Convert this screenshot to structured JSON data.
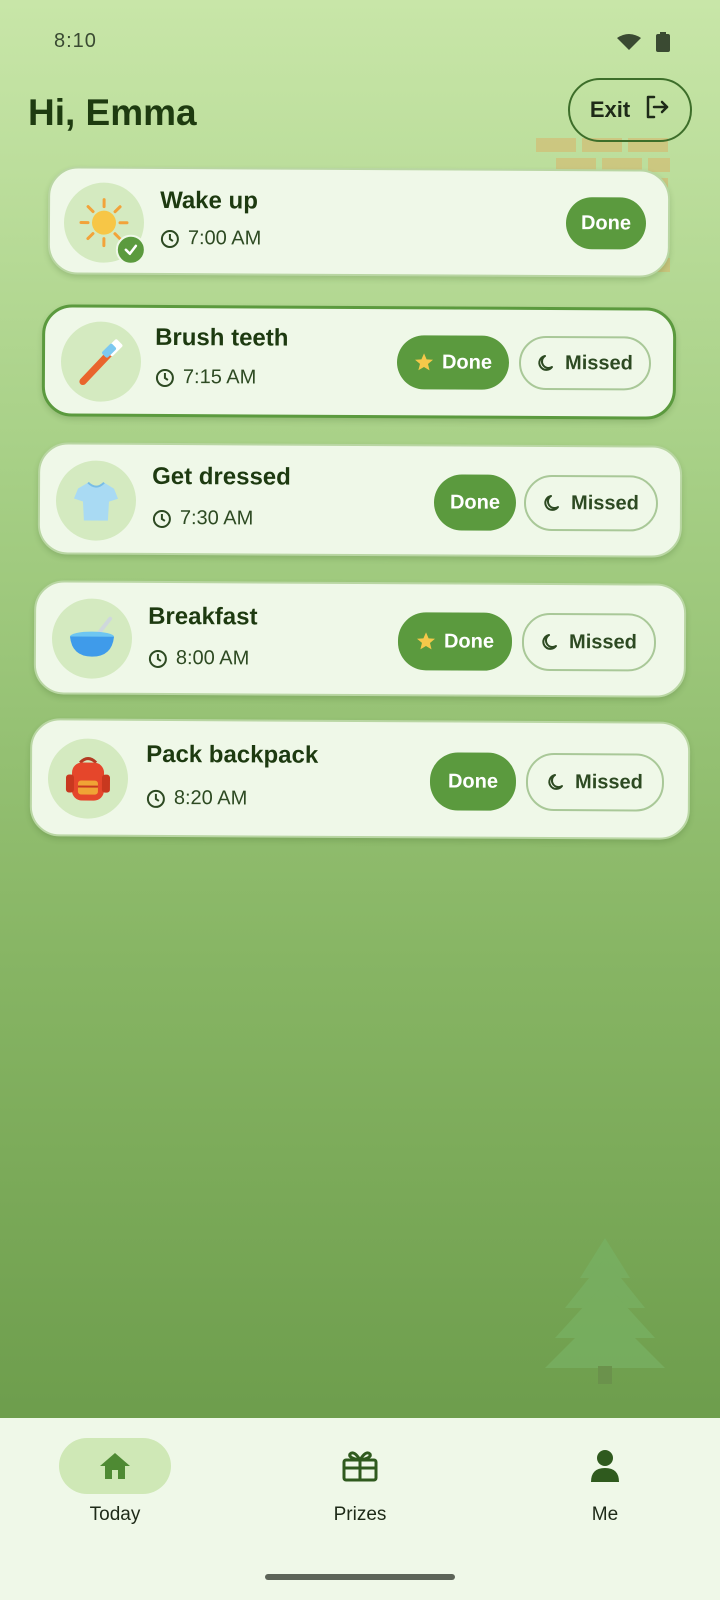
{
  "status_bar": {
    "time": "8:10",
    "icons": [
      "signal-icon",
      "battery-icon"
    ]
  },
  "header": {
    "greeting": "Hi, Emma",
    "exit_label": "Exit"
  },
  "tasks": [
    {
      "title": "Wake up",
      "time": "7:00 AM",
      "icon": "sun-icon",
      "completed": true,
      "done_label": "Done"
    },
    {
      "title": "Brush teeth",
      "time": "7:15 AM",
      "icon": "toothbrush-icon",
      "done_label": "Done",
      "missed_label": "Missed",
      "starred": true
    },
    {
      "title": "Get dressed",
      "time": "7:30 AM",
      "icon": "tshirt-icon",
      "done_label": "Done",
      "missed_label": "Missed"
    },
    {
      "title": "Breakfast",
      "time": "8:00 AM",
      "icon": "bowl-icon",
      "done_label": "Done",
      "missed_label": "Missed",
      "starred": true
    },
    {
      "title": "Pack backpack",
      "time": "8:20 AM",
      "icon": "backpack-icon",
      "done_label": "Done",
      "missed_label": "Missed"
    }
  ],
  "nav": [
    {
      "label": "Today",
      "icon": "home-icon",
      "active": true
    },
    {
      "label": "Prizes",
      "icon": "gift-icon"
    },
    {
      "label": "Me",
      "icon": "person-icon"
    }
  ],
  "colors": {
    "accent": "#5b9a3e",
    "card": "#eff8e8",
    "title": "#1d3a10"
  }
}
